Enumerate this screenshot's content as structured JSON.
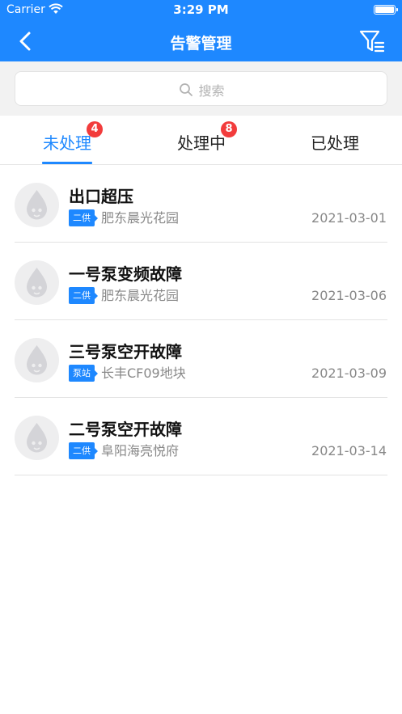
{
  "status_bar": {
    "carrier": "Carrier",
    "time": "3:29 PM"
  },
  "nav": {
    "title": "告警管理",
    "back_icon": "chevron-left-icon",
    "filter_icon": "filter-list-icon"
  },
  "search": {
    "placeholder": "搜索"
  },
  "tabs": [
    {
      "label": "未处理",
      "badge": "4",
      "active": true
    },
    {
      "label": "处理中",
      "badge": "8",
      "active": false
    },
    {
      "label": "已处理",
      "badge": "",
      "active": false
    }
  ],
  "alarms": [
    {
      "title": "出口超压",
      "tag": "二供",
      "location": "肥东晨光花园",
      "date": "2021-03-01"
    },
    {
      "title": "一号泵变频故障",
      "tag": "二供",
      "location": "肥东晨光花园",
      "date": "2021-03-06"
    },
    {
      "title": "三号泵空开故障",
      "tag": "泵站",
      "location": "长丰CF09地块",
      "date": "2021-03-09"
    },
    {
      "title": "二号泵空开故障",
      "tag": "二供",
      "location": "阜阳海亮悦府",
      "date": "2021-03-14"
    }
  ],
  "colors": {
    "primary": "#1e88ff",
    "badge": "#f23c3c",
    "muted_text": "#888888",
    "search_bg": "#f2f2f2"
  }
}
